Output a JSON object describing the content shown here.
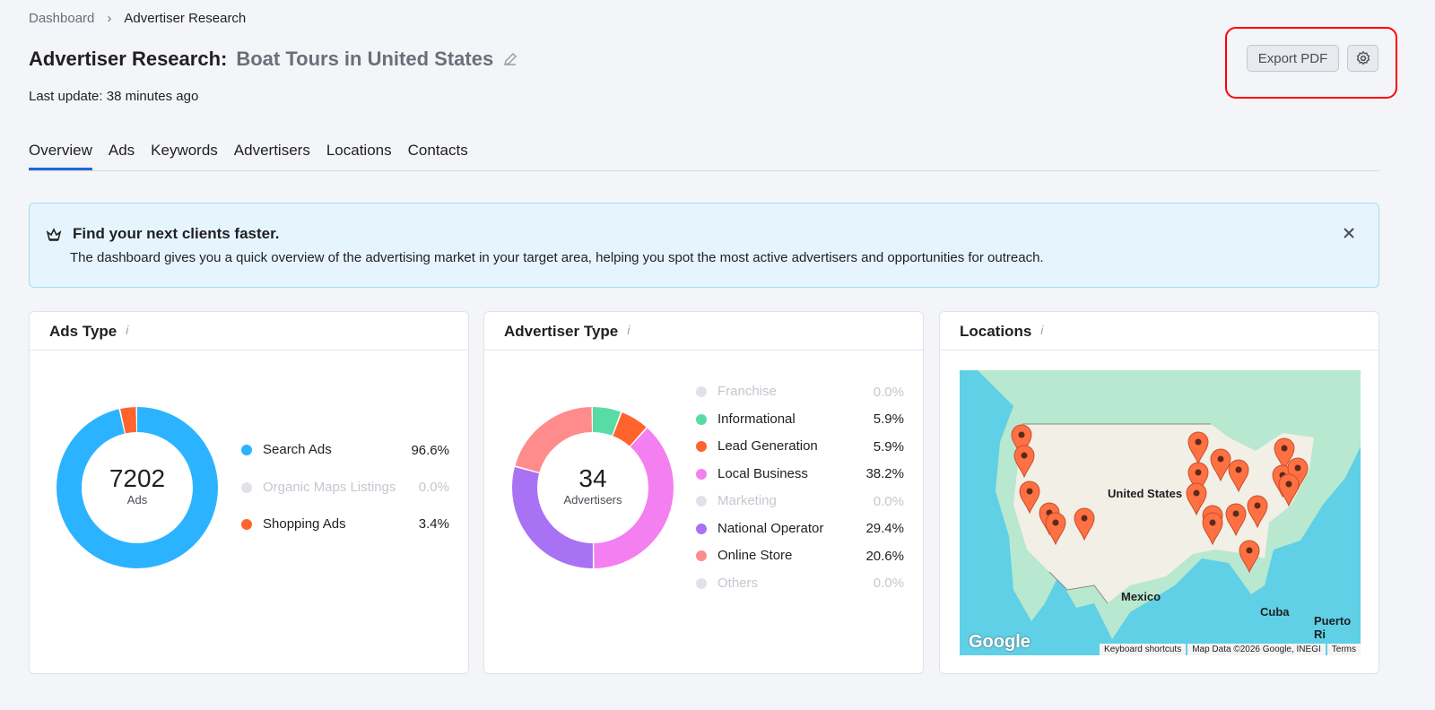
{
  "breadcrumb": {
    "items": [
      "Dashboard",
      "Advertiser Research"
    ],
    "separator": "›"
  },
  "header": {
    "title": "Advertiser Research:",
    "subtitle": "Boat Tours in United States",
    "last_update": "Last update: 38 minutes ago",
    "export_label": "Export PDF"
  },
  "tabs": [
    {
      "label": "Overview",
      "active": true
    },
    {
      "label": "Ads"
    },
    {
      "label": "Keywords"
    },
    {
      "label": "Advertisers"
    },
    {
      "label": "Locations"
    },
    {
      "label": "Contacts"
    }
  ],
  "banner": {
    "title": "Find your next clients faster.",
    "text": "The dashboard gives you a quick overview of the advertising market in your target area, helping you spot the most active advertisers and opportunities for outreach."
  },
  "ads_type": {
    "title": "Ads Type",
    "total": "7202",
    "unit": "Ads",
    "items": [
      {
        "label": "Search Ads",
        "pct": "96.6%",
        "value": 96.6,
        "color": "#2bb3ff"
      },
      {
        "label": "Organic Maps Listings",
        "pct": "0.0%",
        "value": 0,
        "color": "#e0e2e8"
      },
      {
        "label": "Shopping Ads",
        "pct": "3.4%",
        "value": 3.4,
        "color": "#ff642d"
      }
    ]
  },
  "advertiser_type": {
    "title": "Advertiser Type",
    "total": "34",
    "unit": "Advertisers",
    "items": [
      {
        "label": "Franchise",
        "pct": "0.0%",
        "value": 0,
        "color": "#e0e2e8"
      },
      {
        "label": "Informational",
        "pct": "5.9%",
        "value": 5.9,
        "color": "#59dba5"
      },
      {
        "label": "Lead Generation",
        "pct": "5.9%",
        "value": 5.9,
        "color": "#ff642d"
      },
      {
        "label": "Local Business",
        "pct": "38.2%",
        "value": 38.2,
        "color": "#f47ff0"
      },
      {
        "label": "Marketing",
        "pct": "0.0%",
        "value": 0,
        "color": "#e0e2e8"
      },
      {
        "label": "National Operator",
        "pct": "29.4%",
        "value": 29.4,
        "color": "#a972f5"
      },
      {
        "label": "Online Store",
        "pct": "20.6%",
        "value": 20.6,
        "color": "#ff8c8c"
      },
      {
        "label": "Others",
        "pct": "0.0%",
        "value": 0,
        "color": "#e0e2e8"
      }
    ]
  },
  "locations": {
    "title": "Locations",
    "map_labels": {
      "us": "United States",
      "mexico": "Mexico",
      "cuba": "Cuba",
      "pr": "Puerto Ri"
    },
    "footer": {
      "logo": "Google",
      "shortcuts": "Keyboard shortcuts",
      "data": "Map Data ©2026 Google, INEGI",
      "terms": "Terms"
    },
    "pin_color": "#ff7043"
  }
}
